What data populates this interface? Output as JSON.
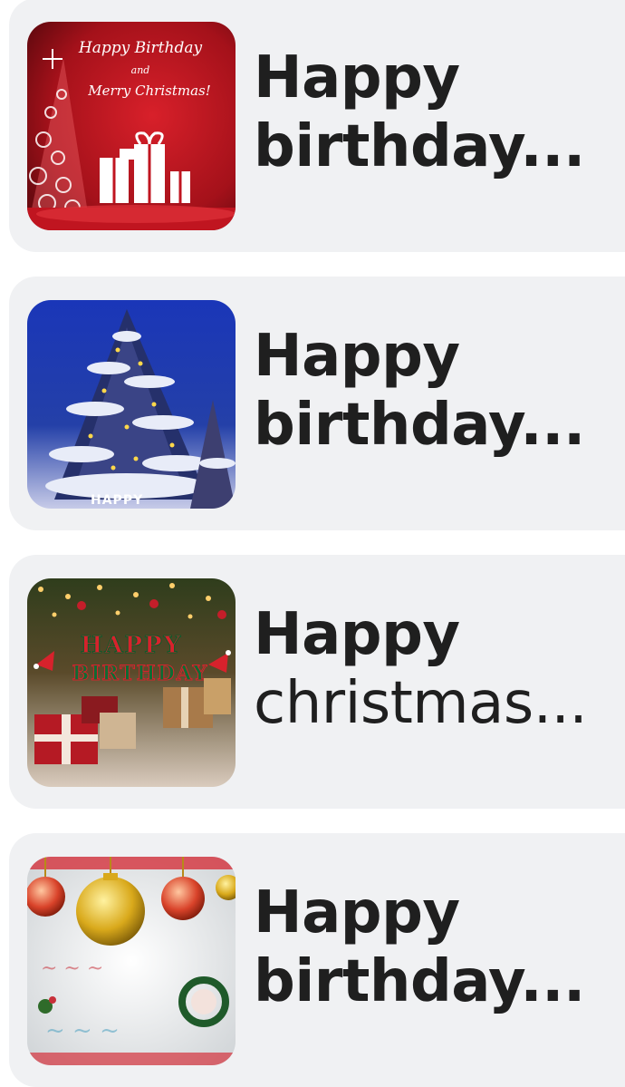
{
  "items": [
    {
      "title_line1": "Happy",
      "title_line2": "birthday...",
      "thumb_icon": "birthday-christmas-card-image",
      "thumb_text_line1": "Happy Birthday",
      "thumb_text_line2": "and",
      "thumb_text_line3": "Merry Christmas!"
    },
    {
      "title_line1": "Happy",
      "title_line2": "birthday...",
      "thumb_icon": "snowy-tree-image",
      "thumb_caption": "HAPPY"
    },
    {
      "title_line1": "Happy",
      "title_line2": "christmas...",
      "thumb_icon": "christmas-presents-image",
      "thumb_banner_line1": "HAPPY",
      "thumb_banner_line2": "BIRTHDAY"
    },
    {
      "title_line1": "Happy",
      "title_line2": "birthday...",
      "thumb_icon": "ornaments-image"
    }
  ],
  "colors": {
    "card_bg": "#f0f1f3",
    "title_text": "#1f1f1f"
  }
}
